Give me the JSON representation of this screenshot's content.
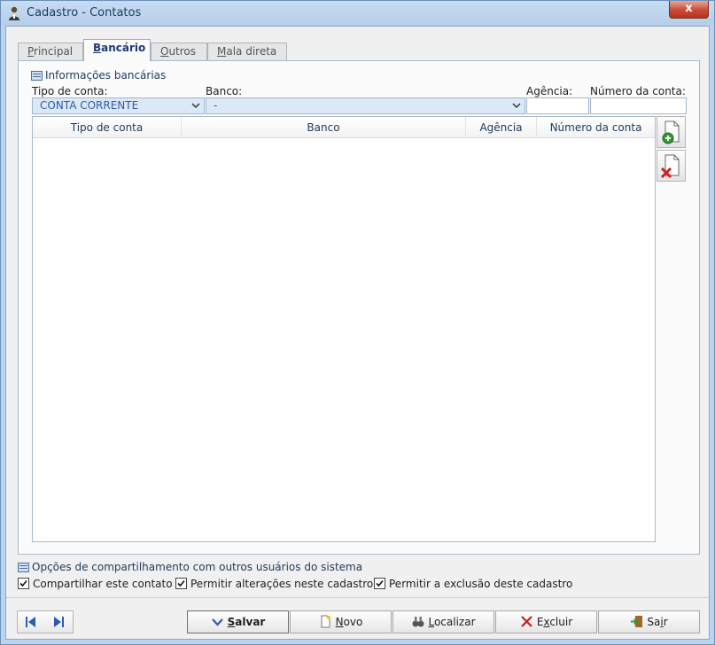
{
  "window": {
    "title": "Cadastro - Contatos",
    "close_label": "x"
  },
  "tabs": [
    {
      "label": "Principal",
      "accel": "P",
      "rest": "rincipal"
    },
    {
      "label": "Bancário",
      "accel": "B",
      "rest": "ancário"
    },
    {
      "label": "Outros",
      "accel": "O",
      "rest": "utros"
    },
    {
      "label": "Mala direta",
      "accel": "M",
      "rest": "ala direta"
    }
  ],
  "bank_section": {
    "header": "Informações bancárias",
    "tipo_label": "Tipo de conta:",
    "tipo_value": "CONTA CORRENTE",
    "banco_label": "Banco:",
    "banco_value": "-",
    "agencia_label": "Agência:",
    "numero_label": "Número da conta:"
  },
  "grid": {
    "columns": [
      "Tipo de conta",
      "Banco",
      "Agência",
      "Número da conta"
    ]
  },
  "share": {
    "header": "Opções de compartilhamento com outros usuários do sistema",
    "options": [
      {
        "label": "Compartilhar este contato",
        "checked": true
      },
      {
        "label": "Permitir alterações neste cadastro",
        "checked": true
      },
      {
        "label": "Permitir a exclusão deste cadastro",
        "checked": true
      }
    ]
  },
  "actions": {
    "salvar": {
      "accel": "S",
      "rest": "alvar"
    },
    "novo": {
      "accel": "N",
      "rest": "ovo"
    },
    "localizar": {
      "accel": "L",
      "rest": "ocalizar"
    },
    "excluir": {
      "pre": "E",
      "accel": "x",
      "rest": "cluir"
    },
    "sair": {
      "pre": "Sa",
      "accel": "i",
      "rest": "r"
    }
  },
  "colors": {
    "accent": "#2a5db0",
    "title_bar": "#bcd5ee",
    "close": "#c94a35"
  }
}
